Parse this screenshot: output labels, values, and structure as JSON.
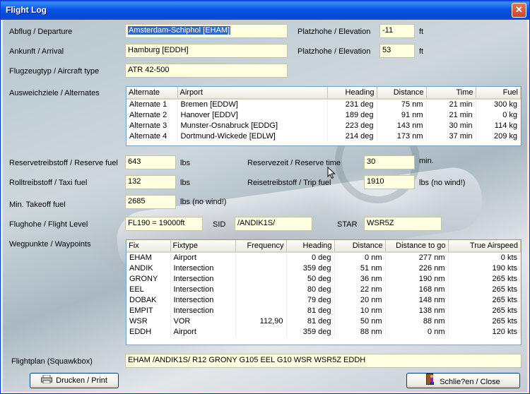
{
  "window": {
    "title": "Flight Log",
    "close_glyph": "✕"
  },
  "labels": {
    "departure": "Abflug / Departure",
    "arrival": "Ankunft / Arrival",
    "aircraft": "Flugzeugtyp / Aircraft type",
    "elevation1": "Platzhohe / Elevation",
    "elevation2": "Platzhohe / Elevation",
    "alternates": "Ausweichziele / Alternates",
    "reserve_fuel": "Reservetreibstoff / Reserve fuel",
    "taxi_fuel": "Rolltreibstoff / Taxi fuel",
    "min_takeoff_fuel": "Min. Takeoff fuel",
    "reserve_time": "Reservezeit / Reserve time",
    "trip_fuel": "Reisetreibstoff / Trip fuel",
    "flight_level": "Flughohe / Flight Level",
    "sid": "SID",
    "star": "STAR",
    "waypoints": "Wegpunkte / Waypoints",
    "flightplan": "Flightplan (Squawkbox)"
  },
  "values": {
    "departure": "Amsterdam-Schiphol [EHAM]",
    "arrival": "Hamburg [EDDH]",
    "aircraft": "ATR 42-500",
    "dep_elevation": "-11",
    "arr_elevation": "53",
    "reserve_fuel": "643",
    "taxi_fuel": "132",
    "min_takeoff_fuel": "2685",
    "reserve_time": "30",
    "trip_fuel": "1910",
    "flight_level": "FL190 = 19000ft",
    "sid": "/ANDIK1S/",
    "star": "WSR5Z",
    "flightplan": "EHAM /ANDIK1S/ R12 GRONY G105 EEL G10  WSR  WSR5Z EDDH"
  },
  "units": {
    "ft1": "ft",
    "ft2": "ft",
    "lbs_reserve": "lbs",
    "lbs_taxi": "lbs",
    "lbs_takeoff": "lbs (no wind!)",
    "min": "min.",
    "lbs_trip": "lbs (no wind!)"
  },
  "alternates": {
    "headers": [
      "Alternate",
      "Airport",
      "Heading",
      "Distance",
      "Time",
      "Fuel"
    ],
    "rows": [
      [
        "Alternate 1",
        "Bremen [EDDW]",
        "231 deg",
        "75 nm",
        "21 min",
        "300 kg"
      ],
      [
        "Alternate 2",
        "Hanover [EDDV]",
        "189 deg",
        "91 nm",
        "21 min",
        "0 kg"
      ],
      [
        "Alternate 3",
        "Munster-Osnabruck [EDDG]",
        "223 deg",
        "143 nm",
        "30 min",
        "114 kg"
      ],
      [
        "Alternate 4",
        "Dortmund-Wickede [EDLW]",
        "214 deg",
        "173 nm",
        "37 min",
        "209 kg"
      ]
    ]
  },
  "waypoints": {
    "headers": [
      "Fix",
      "Fixtype",
      "Frequency",
      "Heading",
      "Distance",
      "Distance to go",
      "True Airspeed"
    ],
    "rows": [
      [
        "EHAM",
        "Airport",
        "",
        "0 deg",
        "0 nm",
        "277 nm",
        "0 kts"
      ],
      [
        "ANDIK",
        "Intersection",
        "",
        "359 deg",
        "51 nm",
        "226 nm",
        "190 kts"
      ],
      [
        "GRONY",
        "Intersection",
        "",
        "50 deg",
        "36 nm",
        "190 nm",
        "265 kts"
      ],
      [
        "EEL",
        "Intersection",
        "",
        "80 deg",
        "22 nm",
        "168 nm",
        "265 kts"
      ],
      [
        "DOBAK",
        "Intersection",
        "",
        "79 deg",
        "20 nm",
        "148 nm",
        "265 kts"
      ],
      [
        "EMPIT",
        "Intersection",
        "",
        "81 deg",
        "10 nm",
        "138 nm",
        "265 kts"
      ],
      [
        "WSR",
        "VOR",
        "112,90",
        "81 deg",
        "50 nm",
        "88 nm",
        "265 kts"
      ],
      [
        "EDDH",
        "Airport",
        "",
        "359 deg",
        "88 nm",
        "0 nm",
        "120 kts"
      ]
    ]
  },
  "buttons": {
    "print": "Drucken / Print",
    "close": "Schlie?en / Close",
    "print_icon": "printer-icon",
    "close_icon": "door-exit-icon"
  },
  "colors": {
    "titlebar": "#0a56e3",
    "field_bg": "#ffffe1",
    "selection": "#316ac5"
  }
}
